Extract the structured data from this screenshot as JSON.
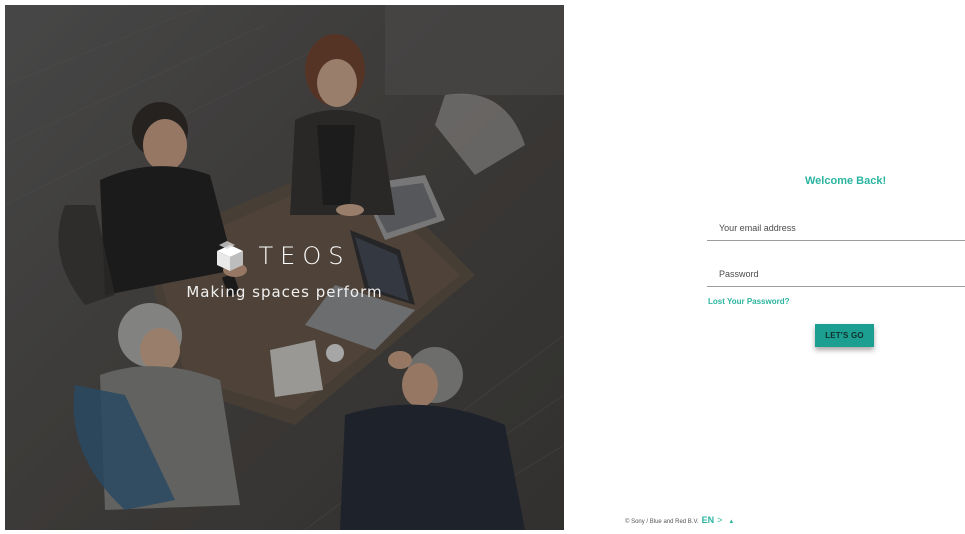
{
  "hero": {
    "brand_name": "TEOS",
    "tagline": "Making spaces perform",
    "logo_icon": "teos-cube-logo-icon"
  },
  "login": {
    "welcome": "Welcome Back!",
    "email_placeholder": "Your email address",
    "password_placeholder": "Password",
    "lost_password": "Lost Your Password?",
    "submit_label": "LET'S GO"
  },
  "footer": {
    "copyright": "© Sony / Blue and Red B.V.",
    "language": "EN",
    "language_arrow": ">",
    "language_caret": "▲"
  },
  "colors": {
    "accent": "#2bb5a0",
    "button": "#1c9f91"
  }
}
